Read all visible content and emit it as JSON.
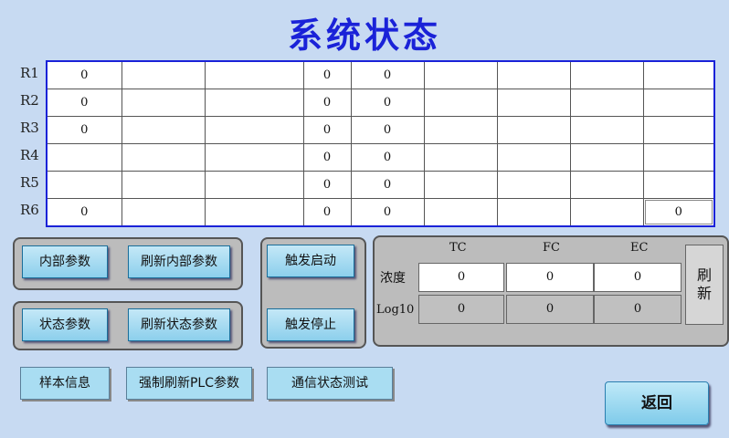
{
  "title": "系统状态",
  "row_labels": [
    "R1",
    "R2",
    "R3",
    "R4",
    "R5",
    "R6"
  ],
  "grid": [
    [
      "0",
      "",
      "",
      "0",
      "0",
      "",
      "",
      "",
      ""
    ],
    [
      "0",
      "",
      "",
      "0",
      "0",
      "",
      "",
      "",
      ""
    ],
    [
      "0",
      "",
      "",
      "0",
      "0",
      "",
      "",
      "",
      ""
    ],
    [
      "",
      "",
      "",
      "0",
      "0",
      "",
      "",
      "",
      ""
    ],
    [
      "",
      "",
      "",
      "0",
      "0",
      "",
      "",
      "",
      ""
    ],
    [
      "0",
      "",
      "",
      "0",
      "0",
      "",
      "",
      "",
      "0"
    ]
  ],
  "buttons": {
    "internal_params": "内部参数",
    "refresh_internal_params": "刷新内部参数",
    "state_params": "状态参数",
    "refresh_state_params": "刷新状态参数",
    "trigger_start": "触发启动",
    "trigger_stop": "触发停止",
    "sample_info": "样本信息",
    "force_refresh_plc": "强制刷新PLC参数",
    "comm_test": "通信状态测试",
    "refresh": "刷新",
    "back": "返回"
  },
  "sensor": {
    "headers": [
      "TC",
      "FC",
      "EC"
    ],
    "conc_label": "浓度",
    "log_label": "Log10",
    "conc_values": [
      "0",
      "0",
      "0"
    ],
    "log_values": [
      "0",
      "0",
      "0"
    ]
  }
}
